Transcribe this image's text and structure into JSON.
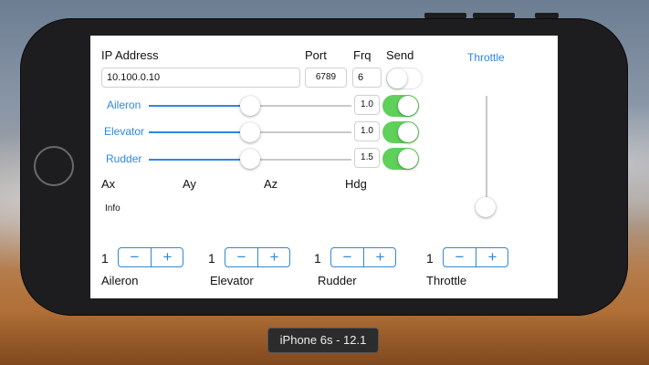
{
  "simulator_label": "iPhone 6s - 12.1",
  "header": {
    "ip_label": "IP Address",
    "port_label": "Port",
    "frq_label": "Frq",
    "send_label": "Send",
    "throttle_label": "Throttle"
  },
  "inputs": {
    "ip_value": "10.100.0.10",
    "port_value": "6789",
    "frq_value": "6"
  },
  "send_toggle_on": false,
  "sliders": [
    {
      "label": "Aileron",
      "value_text": "1.0",
      "level": 0.5,
      "toggle_on": true
    },
    {
      "label": "Elevator",
      "value_text": "1.0",
      "level": 0.5,
      "toggle_on": true
    },
    {
      "label": "Rudder",
      "value_text": "1.5",
      "level": 0.5,
      "toggle_on": true
    }
  ],
  "throttle_level": 0,
  "readouts": [
    "Ax",
    "Ay",
    "Az",
    "Hdg"
  ],
  "info_label": "Info",
  "steppers": [
    {
      "value": "1",
      "label": "Aileron"
    },
    {
      "value": "1",
      "label": "Elevator"
    },
    {
      "value": "1",
      "label": "Rudder"
    },
    {
      "value": "1",
      "label": "Throttle"
    }
  ],
  "stepper_minus": "−",
  "stepper_plus": "+",
  "colors": {
    "accent": "#2f87e0",
    "toggle_on": "#5fd05a"
  }
}
